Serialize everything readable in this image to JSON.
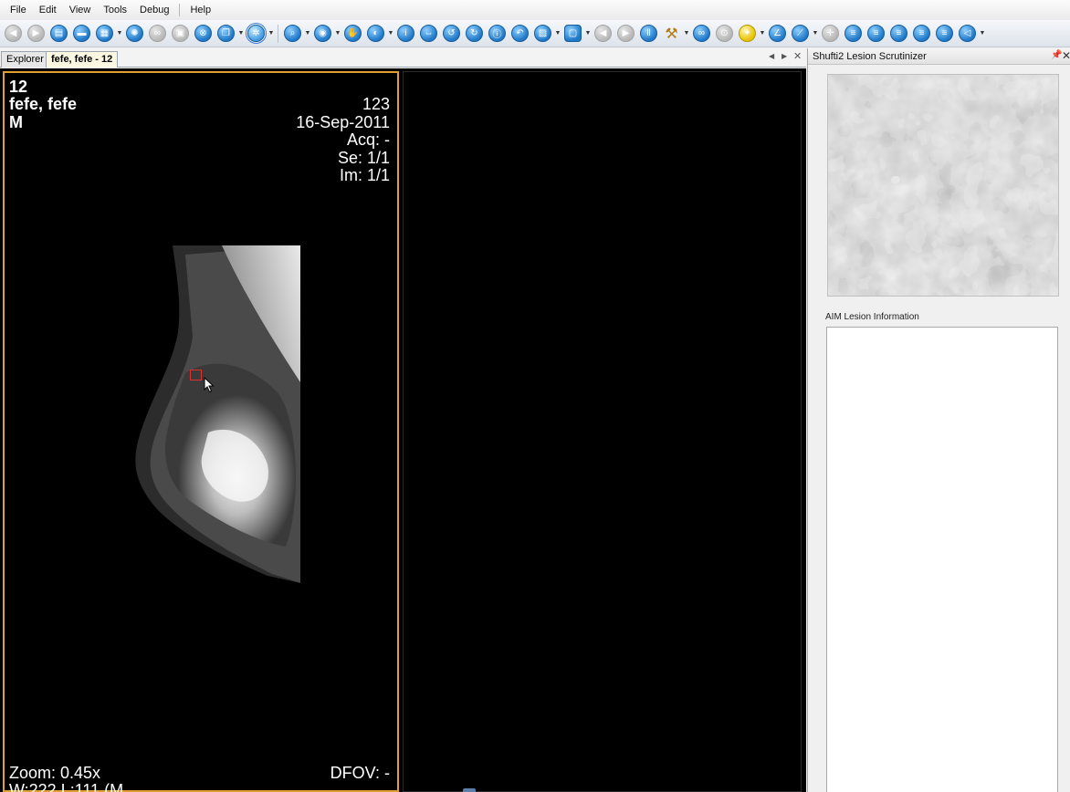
{
  "menu": [
    "File",
    "Edit",
    "View",
    "Tools",
    "Debug",
    "Help"
  ],
  "tabs": {
    "explorer": "Explorer",
    "viewer": "fefe, fefe - 12"
  },
  "overlay": {
    "patient_id": "12",
    "patient_name": "fefe, fefe",
    "sex": "M",
    "study_id": "123",
    "study_date": "16-Sep-2011",
    "acquisition": "Acq: -",
    "series": "Se: 1/1",
    "image": "Im: 1/1",
    "zoom": "Zoom: 0.45x",
    "window_level": "W:222 L:111 (M",
    "dfov": "DFOV: -"
  },
  "side_panel": {
    "title": "Shufti2 Lesion Scrutinizer",
    "aim_label": "AIM Lesion Information"
  },
  "colors": {
    "accent": "#e0a030",
    "roi": "#e03030",
    "toolbar_blue": "#1f78c8"
  }
}
